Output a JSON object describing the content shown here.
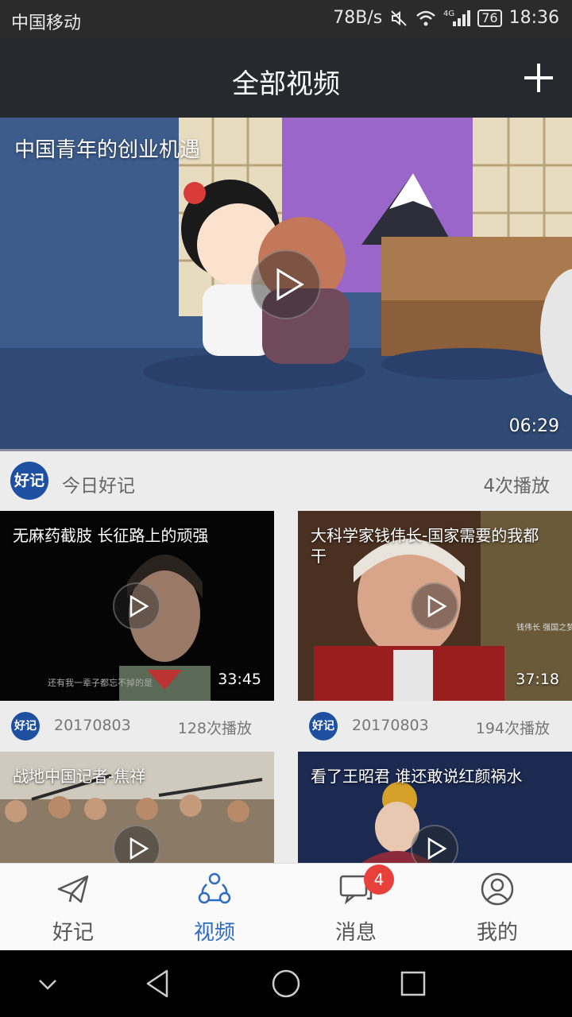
{
  "status_bar": {
    "carrier": "中国移动",
    "speed": "78B/s",
    "network": "4G",
    "battery": "76",
    "time": "18:36"
  },
  "header": {
    "title": "全部视频",
    "add_icon": "plus-icon"
  },
  "featured": {
    "title": "中国青年的创业机遇",
    "duration": "06:29",
    "channel_logo": "好记",
    "channel": "今日好记",
    "plays": "4次播放"
  },
  "videos": [
    {
      "title": "无麻药截肢 长征路上的顽强",
      "duration": "33:45",
      "logo": "好记",
      "date": "20170803",
      "plays": "128次播放",
      "subtitle": "还有我一辈子都忘不掉的是"
    },
    {
      "title": "大科学家钱伟长-国家需要的我都干",
      "duration": "37:18",
      "logo": "好记",
      "date": "20170803",
      "plays": "194次播放",
      "caption": "钱伟长 强国之梦"
    },
    {
      "title": "战地中国记者-焦祥"
    },
    {
      "title": "看了王昭君 谁还敢说红颜祸水"
    }
  ],
  "tabs": [
    {
      "label": "好记",
      "icon": "paper-plane-icon"
    },
    {
      "label": "视频",
      "icon": "share-circles-icon"
    },
    {
      "label": "消息",
      "icon": "chat-icon",
      "badge": "4"
    },
    {
      "label": "我的",
      "icon": "user-icon"
    }
  ],
  "colors": {
    "accent": "#2d6bc4",
    "header_bg": "#262a2e",
    "badge": "#e8413b"
  }
}
